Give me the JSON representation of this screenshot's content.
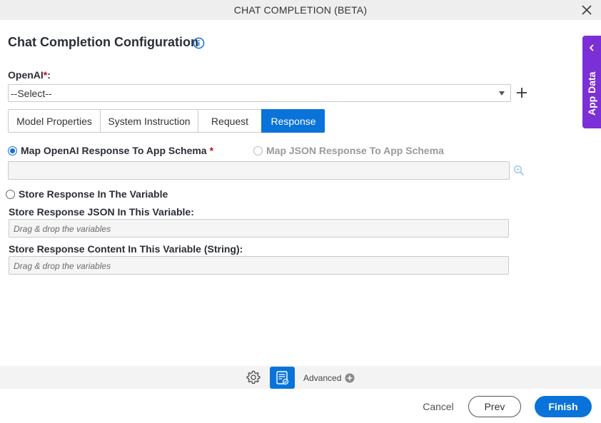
{
  "window": {
    "title": "CHAT COMPLETION (BETA)"
  },
  "page": {
    "heading": "Chat Completion Configuration"
  },
  "openai": {
    "label": "OpenAI",
    "required_mark": "*",
    "suffix": ":",
    "selected": "--Select--"
  },
  "tabs": [
    {
      "label": "Model Properties",
      "active": false
    },
    {
      "label": "System Instruction",
      "active": false
    },
    {
      "label": "Request",
      "active": false
    },
    {
      "label": "Response",
      "active": true
    }
  ],
  "response": {
    "map_openai_label": "Map OpenAI Response To App Schema",
    "map_openai_required": "*",
    "map_json_label": "Map JSON Response To App Schema",
    "schema_value": "",
    "store_var_label": "Store Response In The Variable",
    "json_var_label": "Store Response JSON In This Variable:",
    "json_var_placeholder": "Drag & drop the variables",
    "content_var_label": "Store Response Content In This Variable (String):",
    "content_var_placeholder": "Drag & drop the variables"
  },
  "side_panel": {
    "label": "App Data"
  },
  "toolbar": {
    "advanced_label": "Advanced"
  },
  "footer": {
    "cancel": "Cancel",
    "prev": "Prev",
    "finish": "Finish"
  },
  "colors": {
    "accent": "#0a73d9",
    "app_data": "#7b2fd6",
    "required": "#d0021b"
  }
}
